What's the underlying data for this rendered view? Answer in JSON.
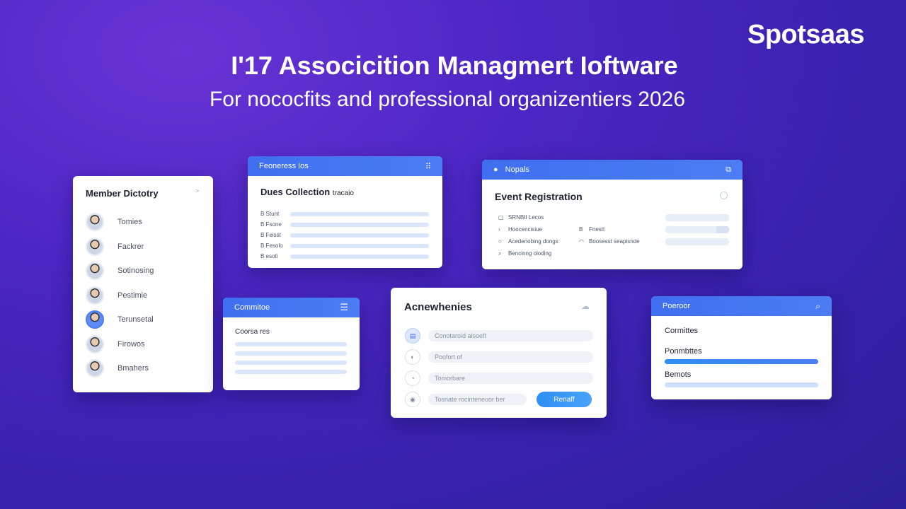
{
  "brand": "Spotsaas",
  "headline": "I'17 Associcition Managmert Ioftware",
  "subline": "For nococfits and professional organizentiers 2026",
  "member_directory": {
    "title": "Member Dictotry",
    "chevron": ">",
    "members": [
      "Tomies",
      "Fackrer",
      "Sotinosing",
      "Pestimie",
      "Terunsetal",
      "Firowos",
      "Bmahers"
    ]
  },
  "dues_collection": {
    "header": "Feoneress Ios",
    "title": "Dues Collection",
    "title_suffix": "tracaio",
    "rows": [
      "B Stunt",
      "B Fsone",
      "B Feisst",
      "B Fesolo",
      "B esoti"
    ]
  },
  "event_registration": {
    "header": "Nopals",
    "title": "Event Registration",
    "rows": [
      {
        "icon": "▢",
        "label": "SRNBII Lecos"
      },
      {
        "icon": "›",
        "label": "Hoocencisiue"
      },
      {
        "icon": "○",
        "label": "Acedenobing dongs"
      },
      {
        "icon": "⌕",
        "label": "Bencinng oloding"
      }
    ],
    "mid_rows": [
      {
        "icon": "B",
        "label": "Fnestt"
      },
      {
        "icon": "◠",
        "label": "Boosesst seapisnde"
      }
    ]
  },
  "committee": {
    "header": "Commitoe",
    "title": "Coorsa res"
  },
  "achievements": {
    "title": "Acnewhenies",
    "rows": [
      {
        "icon": "▤",
        "placeholder": "Conotaroid alsoefl"
      },
      {
        "icon": "◐",
        "placeholder": "Poofort of"
      },
      {
        "icon": "◔",
        "placeholder": "Tomorbare"
      },
      {
        "icon": "◉",
        "placeholder": "Tosnate rocinteneuor ber"
      }
    ],
    "button": "Renaff"
  },
  "program": {
    "header": "Poeroor",
    "label1": "Cormittes",
    "label2": "Ponmbttes",
    "label3": "Bemots"
  },
  "colors": {
    "accent": "#3f6ff0",
    "background": "#4b26c4",
    "button": "#2f8ef2"
  }
}
